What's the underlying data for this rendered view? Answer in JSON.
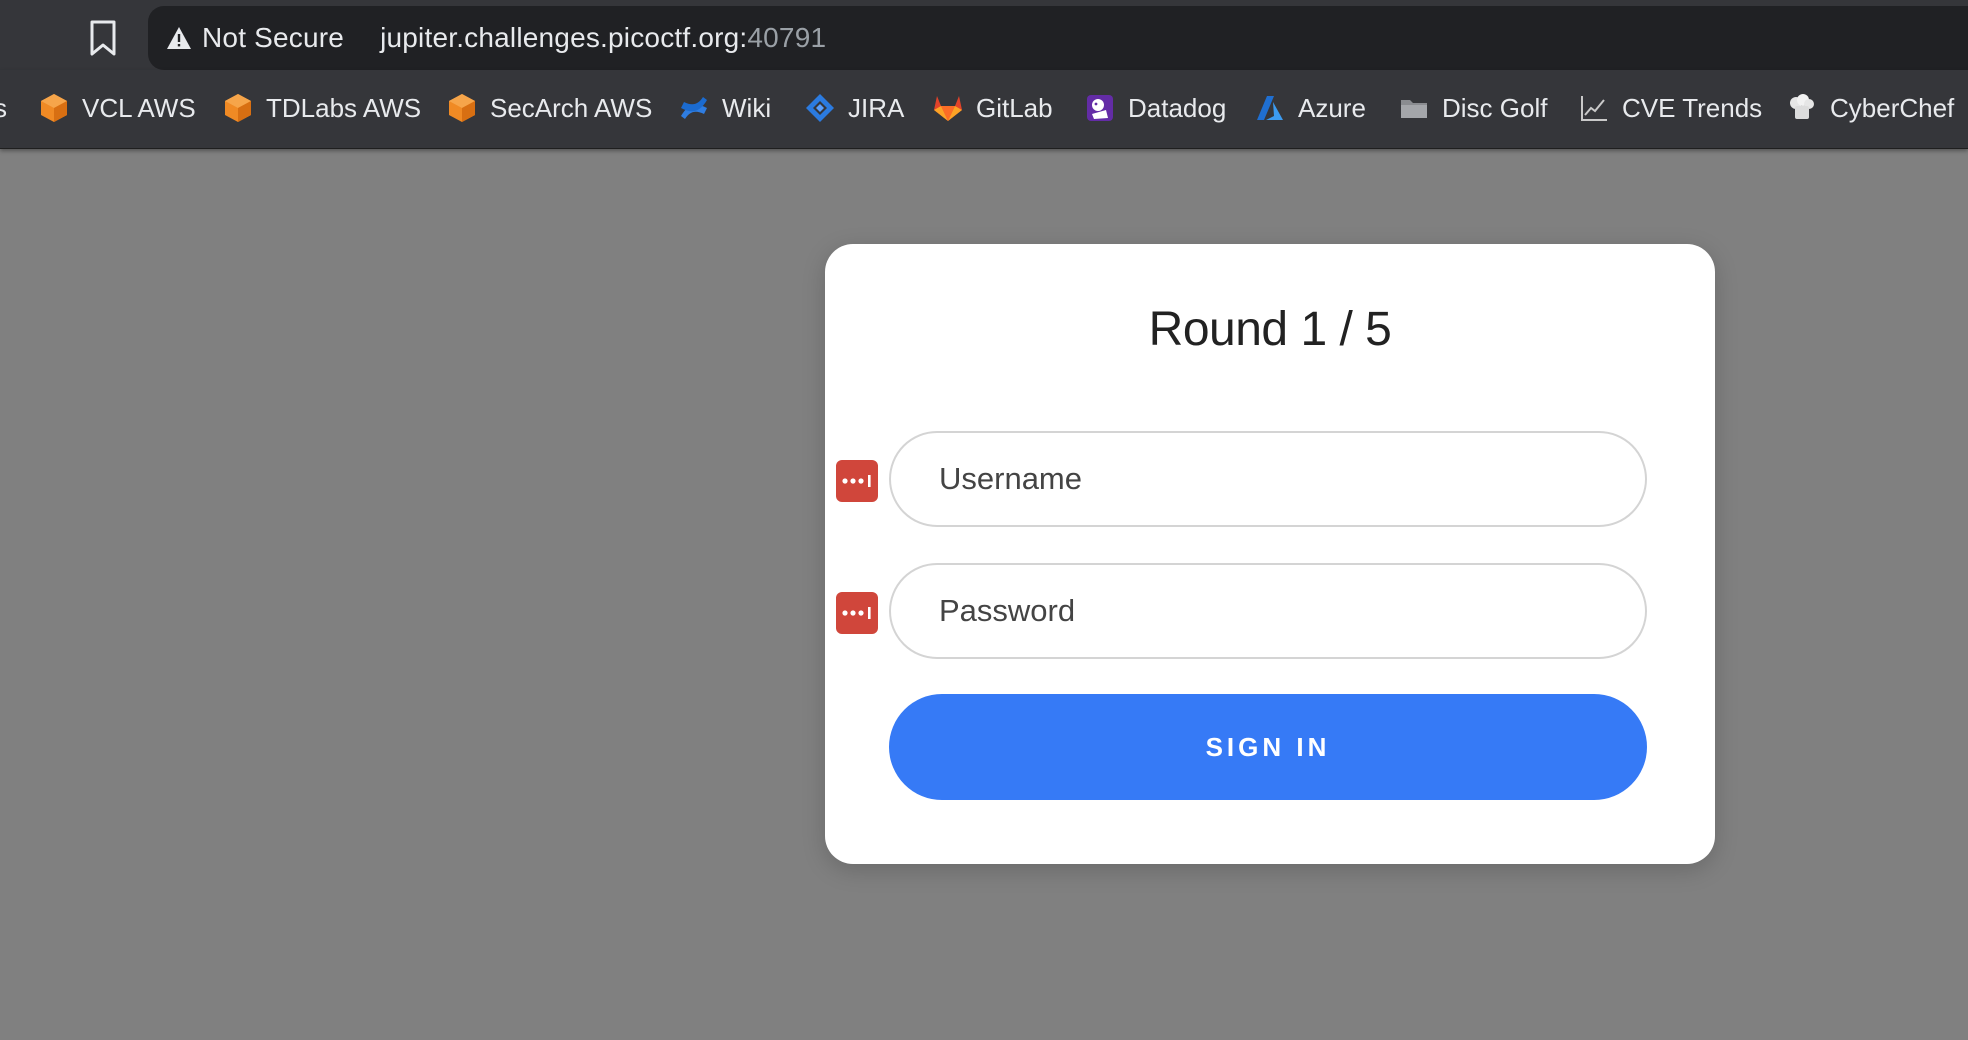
{
  "browser": {
    "security_label": "Not Secure",
    "url_host": "jupiter.challenges.picoctf.org:",
    "url_port": "40791",
    "bookmark_fragment": "s",
    "bookmarks": [
      {
        "label": "VCL AWS",
        "icon": "aws-cube-icon"
      },
      {
        "label": "TDLabs AWS",
        "icon": "aws-cube-icon"
      },
      {
        "label": "SecArch AWS",
        "icon": "aws-cube-icon"
      },
      {
        "label": "Wiki",
        "icon": "confluence-icon"
      },
      {
        "label": "JIRA",
        "icon": "jira-icon"
      },
      {
        "label": "GitLab",
        "icon": "gitlab-icon"
      },
      {
        "label": "Datadog",
        "icon": "datadog-icon"
      },
      {
        "label": "Azure",
        "icon": "azure-icon"
      },
      {
        "label": "Disc Golf",
        "icon": "folder-icon"
      },
      {
        "label": "CVE Trends",
        "icon": "trend-chart-icon"
      },
      {
        "label": "CyberChef",
        "icon": "chef-hat-icon"
      }
    ]
  },
  "login": {
    "title": "Round 1 / 5",
    "username_placeholder": "Username",
    "password_placeholder": "Password",
    "submit_label": "SIGN IN"
  },
  "colors": {
    "page_background": "#808080",
    "button": "#367af6",
    "password_manager_badge": "#d0463b"
  }
}
